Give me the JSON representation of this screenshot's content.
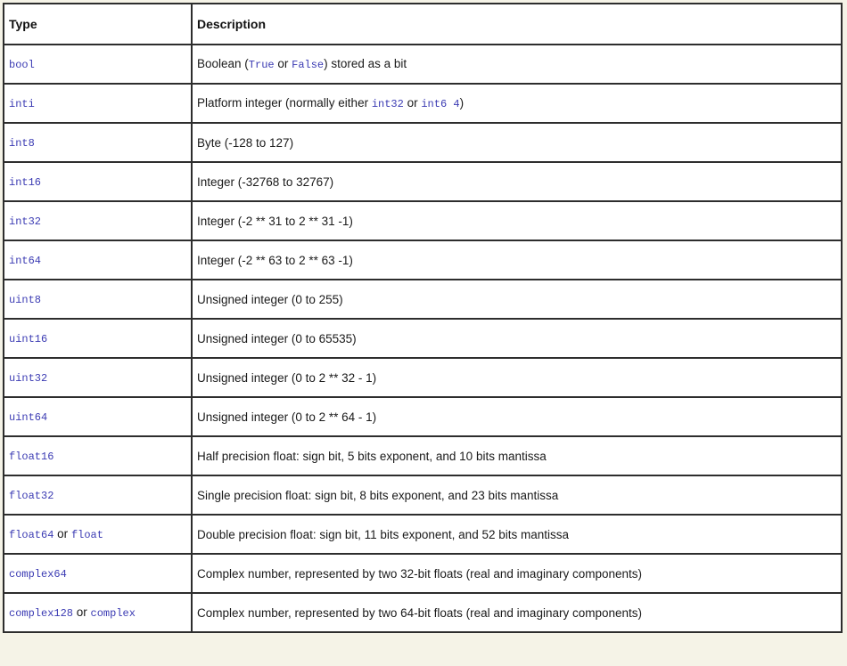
{
  "page": {
    "background_color": "#f5f3e7",
    "table_border_color": "#2d2d2d",
    "code_color": "#3b3bb3"
  },
  "table": {
    "headers": [
      "Type",
      "Description"
    ],
    "rows": [
      {
        "type": [
          {
            "text": "bool",
            "code": true
          }
        ],
        "desc": [
          {
            "text": "Boolean (",
            "code": false
          },
          {
            "text": "True",
            "code": true
          },
          {
            "text": " or ",
            "code": false
          },
          {
            "text": "False",
            "code": true
          },
          {
            "text": ") stored as a bit",
            "code": false
          }
        ]
      },
      {
        "type": [
          {
            "text": "inti",
            "code": true
          }
        ],
        "desc": [
          {
            "text": "Platform integer (normally either ",
            "code": false
          },
          {
            "text": "int32",
            "code": true
          },
          {
            "text": " or ",
            "code": false
          },
          {
            "text": "int6 4",
            "code": true
          },
          {
            "text": ")",
            "code": false
          }
        ]
      },
      {
        "type": [
          {
            "text": "int8",
            "code": true
          }
        ],
        "desc": [
          {
            "text": "Byte (-128 to 127)",
            "code": false
          }
        ]
      },
      {
        "type": [
          {
            "text": "int16",
            "code": true
          }
        ],
        "desc": [
          {
            "text": "Integer (-32768 to 32767)",
            "code": false
          }
        ]
      },
      {
        "type": [
          {
            "text": "int32",
            "code": true
          }
        ],
        "desc": [
          {
            "text": "Integer (-2 ** 31 to 2 ** 31 -1)",
            "code": false
          }
        ]
      },
      {
        "type": [
          {
            "text": "int64",
            "code": true
          }
        ],
        "desc": [
          {
            "text": "Integer (-2 ** 63 to 2 ** 63 -1)",
            "code": false
          }
        ]
      },
      {
        "type": [
          {
            "text": "uint8",
            "code": true
          }
        ],
        "desc": [
          {
            "text": "Unsigned integer (0 to 255)",
            "code": false
          }
        ]
      },
      {
        "type": [
          {
            "text": "uint16",
            "code": true
          }
        ],
        "desc": [
          {
            "text": "Unsigned integer (0 to 65535)",
            "code": false
          }
        ]
      },
      {
        "type": [
          {
            "text": "uint32",
            "code": true
          }
        ],
        "desc": [
          {
            "text": "Unsigned integer (0 to 2 ** 32 - 1)",
            "code": false
          }
        ]
      },
      {
        "type": [
          {
            "text": "uint64",
            "code": true
          }
        ],
        "desc": [
          {
            "text": "Unsigned integer (0 to 2 ** 64 - 1)",
            "code": false
          }
        ]
      },
      {
        "type": [
          {
            "text": "float16",
            "code": true
          }
        ],
        "desc": [
          {
            "text": "Half precision float: sign bit, 5 bits exponent, and 10 bits mantissa",
            "code": false
          }
        ]
      },
      {
        "type": [
          {
            "text": "float32",
            "code": true
          }
        ],
        "desc": [
          {
            "text": "Single precision float: sign bit, 8 bits exponent, and 23 bits mantissa",
            "code": false
          }
        ]
      },
      {
        "type": [
          {
            "text": "float64",
            "code": true
          },
          {
            "text": " or ",
            "code": false
          },
          {
            "text": "float",
            "code": true
          }
        ],
        "desc": [
          {
            "text": "Double precision float: sign bit, 11 bits exponent, and 52 bits mantissa",
            "code": false
          }
        ]
      },
      {
        "type": [
          {
            "text": "complex64",
            "code": true
          }
        ],
        "desc": [
          {
            "text": "Complex number, represented by two 32-bit floats (real and imaginary components)",
            "code": false
          }
        ]
      },
      {
        "type": [
          {
            "text": "complex128",
            "code": true
          },
          {
            "text": " or ",
            "code": false
          },
          {
            "text": "complex",
            "code": true
          }
        ],
        "desc": [
          {
            "text": "Complex number, represented by two 64-bit floats (real and imaginary components)",
            "code": false
          }
        ]
      }
    ]
  }
}
